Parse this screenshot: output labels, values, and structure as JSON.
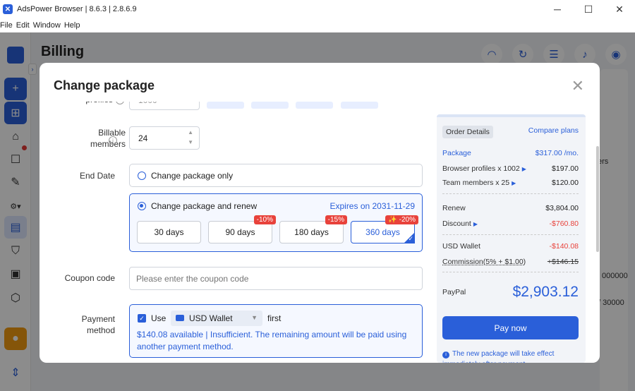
{
  "window": {
    "title": "AdsPower Browser | 8.6.3 | 2.8.6.9",
    "minimize": "─",
    "maximize": "☐",
    "close": "✕"
  },
  "menu": [
    "File",
    "Edit",
    "Window",
    "Help"
  ],
  "page": {
    "title": "Billing",
    "bg_snippets": [
      "ers",
      "000000",
      "/ 30000"
    ]
  },
  "modal": {
    "title": "Change package",
    "close": "✕",
    "profiles_label": "profiles",
    "profiles_value": "1000",
    "billable_label": "Billable members",
    "billable_value": "24",
    "end_date_label": "End Date",
    "option_only": "Change package only",
    "option_renew": "Change package and renew",
    "expires": "Expires on 2031-11-29",
    "durations": [
      {
        "label": "30 days",
        "discount": ""
      },
      {
        "label": "90 days",
        "discount": "-10%"
      },
      {
        "label": "180 days",
        "discount": "-15%"
      },
      {
        "label": "360 days",
        "discount": "✨ -20%"
      }
    ],
    "coupon_label": "Coupon code",
    "coupon_placeholder": "Please enter the coupon code",
    "payment_label": "Payment method",
    "use_label": "Use",
    "wallet_select": "USD Wallet",
    "first_label": "first",
    "wallet_note": "$140.08 available | Insufficient. The remaining amount will be paid using another payment method."
  },
  "order": {
    "tab": "Order Details",
    "compare": "Compare plans",
    "package_label": "Package",
    "package_value": "$317.00 /mo.",
    "profiles_label": "Browser profiles x 1002",
    "profiles_value": "$197.00",
    "team_label": "Team members x 25",
    "team_value": "$120.00",
    "renew_label": "Renew",
    "renew_value": "$3,804.00",
    "discount_label": "Discount",
    "discount_value": "-$760.80",
    "wallet_label": "USD Wallet",
    "wallet_value": "-$140.08",
    "commission_label": "Commission(5% + $1.00)",
    "commission_value": "+$146.15",
    "paypal_label": "PayPal",
    "paypal_value": "$2,903.12",
    "pay_now": "Pay now",
    "note": "The new package will take effect immediately after payment."
  }
}
